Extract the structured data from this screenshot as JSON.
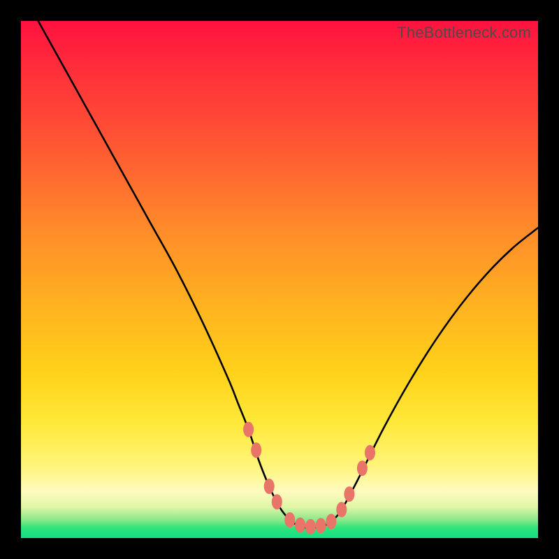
{
  "watermark": "TheBottleneck.com",
  "chart_data": {
    "type": "line",
    "title": "",
    "xlabel": "",
    "ylabel": "",
    "xlim": [
      0,
      100
    ],
    "ylim": [
      0,
      100
    ],
    "series": [
      {
        "name": "bottleneck-curve",
        "x": [
          0,
          5,
          10,
          15,
          20,
          25,
          30,
          35,
          40,
          42,
          44,
          46,
          48,
          50,
          52,
          54,
          55,
          56,
          58,
          60,
          62,
          65,
          70,
          75,
          80,
          85,
          90,
          95,
          100
        ],
        "values": [
          106,
          97,
          88,
          79,
          70,
          61,
          52,
          42,
          31,
          26,
          21,
          15,
          10,
          6,
          3.5,
          2.2,
          2,
          2,
          2.2,
          3.2,
          5.5,
          11,
          21,
          30,
          38,
          45,
          51,
          56,
          60
        ]
      }
    ],
    "markers": [
      {
        "name": "left-marker-1",
        "x": 44.0,
        "y": 21.0
      },
      {
        "name": "left-marker-2",
        "x": 45.5,
        "y": 17.0
      },
      {
        "name": "left-marker-3",
        "x": 48.0,
        "y": 10.0
      },
      {
        "name": "left-marker-4",
        "x": 49.5,
        "y": 7.0
      },
      {
        "name": "bottom-marker-1",
        "x": 52.0,
        "y": 3.5
      },
      {
        "name": "bottom-marker-2",
        "x": 54.0,
        "y": 2.5
      },
      {
        "name": "bottom-marker-3",
        "x": 56.0,
        "y": 2.2
      },
      {
        "name": "bottom-marker-4",
        "x": 58.0,
        "y": 2.4
      },
      {
        "name": "bottom-marker-5",
        "x": 60.0,
        "y": 3.2
      },
      {
        "name": "right-marker-1",
        "x": 62.0,
        "y": 5.5
      },
      {
        "name": "right-marker-2",
        "x": 63.5,
        "y": 8.5
      },
      {
        "name": "right-marker-3",
        "x": 66.0,
        "y": 13.5
      },
      {
        "name": "right-marker-4",
        "x": 67.5,
        "y": 16.5
      }
    ],
    "marker_style": {
      "fill": "#e97468",
      "shape": "rounded-diamond"
    },
    "background_gradient": {
      "top": "#ff123f",
      "mid": "#ffd21a",
      "bottom": "#15df84"
    }
  }
}
